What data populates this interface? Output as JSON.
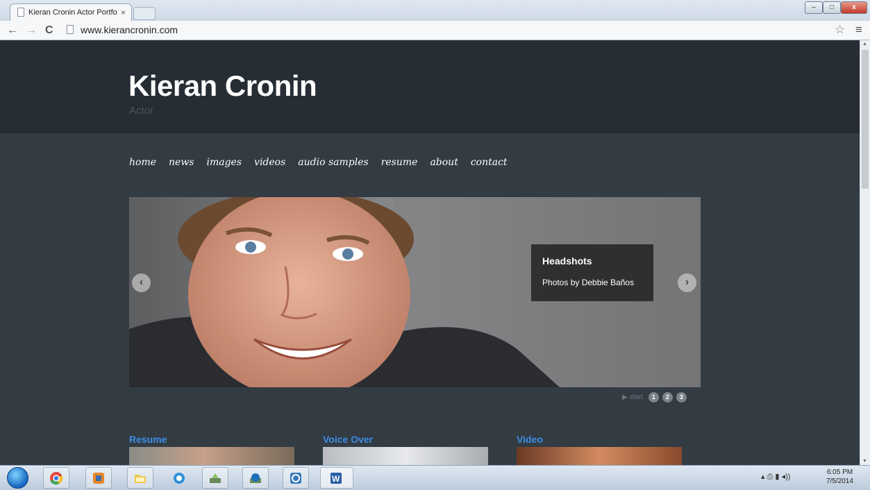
{
  "browser": {
    "tab_title": "Kieran Cronin Actor Portfo",
    "tab_close": "×",
    "url": "www.kierancronin.com",
    "window_min": "–",
    "window_max": "□",
    "window_close": "x"
  },
  "site": {
    "title": "Kieran Cronin",
    "subtitle": "Actor",
    "nav": [
      "home",
      "news",
      "images",
      "videos",
      "audio samples",
      "resume",
      "about",
      "contact"
    ]
  },
  "slider": {
    "caption_title": "Headshots",
    "caption_text": "Photos by Debbie Baños",
    "start_label": "▶ start",
    "pages": [
      "1",
      "2",
      "3"
    ]
  },
  "sections": [
    {
      "title": "Resume"
    },
    {
      "title": "Voice Over"
    },
    {
      "title": "Video"
    }
  ],
  "taskbar": {
    "time": "6:05 PM",
    "date": "7/5/2014"
  },
  "colors": {
    "header_bg": "#262d34",
    "page_bg": "#333b43",
    "accent": "#3d8ee6"
  }
}
